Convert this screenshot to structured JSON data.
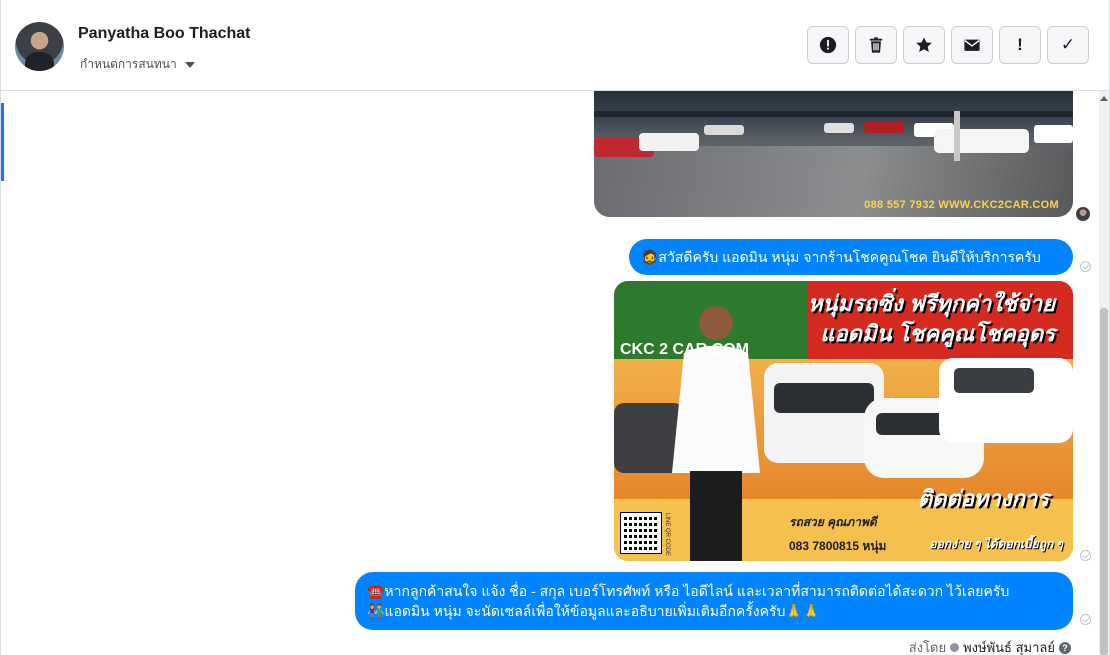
{
  "header": {
    "contact_name": "Panyatha Boo Thachat",
    "assign_label": "กำหนดการสนทนา"
  },
  "actions": [
    {
      "icon": "alert-icon",
      "glyph": ""
    },
    {
      "icon": "trash-icon",
      "glyph": ""
    },
    {
      "icon": "star-icon",
      "glyph": ""
    },
    {
      "icon": "mail-icon",
      "glyph": ""
    },
    {
      "icon": "exclamation-icon",
      "glyph": "!"
    },
    {
      "icon": "checkmark-icon",
      "glyph": "✓"
    }
  ],
  "messages": {
    "image1_watermark": "088 557 7932 WWW.CKC2CAR.COM",
    "greeting": "🧔สวัสดีครับ แอดมิน หนุ่ม จากร้านโชคคูณโชค ยินดีให้บริการครับ",
    "promo_image": {
      "headline_line1": "หนุ่มรถซิ่ง ฟรีทุกค่าใช้จ่าย",
      "headline_line2": "แอดมิน โชคคูณโชคอุดร",
      "logo_text": "CKC 2 CAR.COM",
      "cta": "ติดต่อทางการ",
      "subtitle": "รถสวย คุณภาพดี",
      "phone": "083 7800815 หนุ่ม",
      "subtitle2": "ออกง่าย ๆ ได้ดอกเบี้ยถูก ๆ",
      "line_id": "LINE QR CODE"
    },
    "followup_line1": "☎️หากลูกค้าสนใจ แจ้ง ชื่อ - สกุล เบอร์โทรศัพท์ หรือ ไอดีไลน์ และเวลาที่สามารถติดต่อได้สะดวก ไว้เลยครับ",
    "followup_line2": "👫แอดมิน หนุ่ม จะนัดเซลล์เพื่อให้ข้อมูลและอธิบายเพิ่มเติมอีกครั้งครับ🙏🙏"
  },
  "footer": {
    "sent_by_label": "ส่งโดย",
    "sender_name": "พงษ์พันธ์ สุมาลย์",
    "help_glyph": "?"
  },
  "colors": {
    "bubble": "#0084ff",
    "accent": "#1877f2"
  }
}
